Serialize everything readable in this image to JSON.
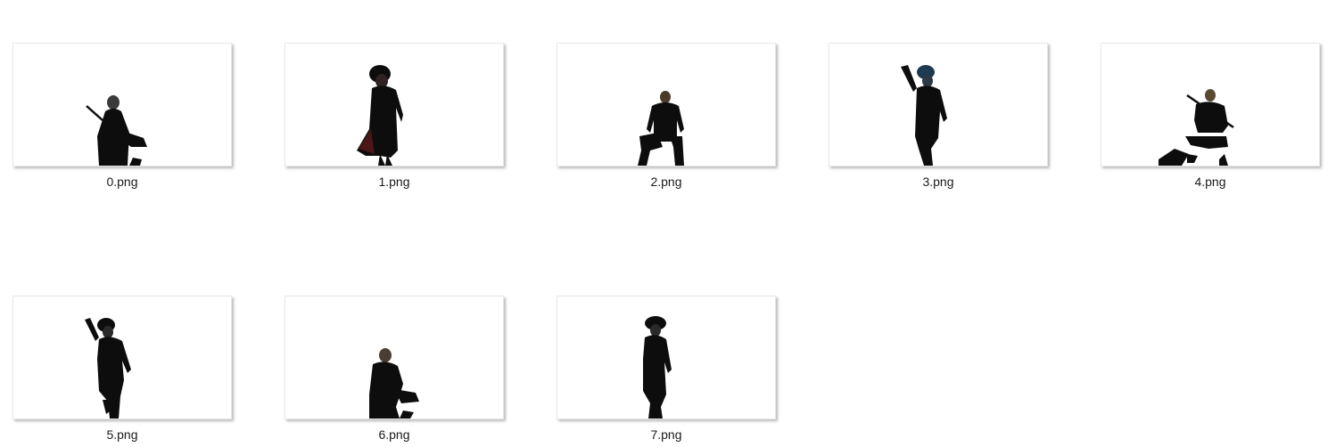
{
  "files": [
    {
      "name": "0.png",
      "thumbnail": "figure-with-sword-crouching-icon"
    },
    {
      "name": "1.png",
      "thumbnail": "figure-in-long-coat-walking-icon"
    },
    {
      "name": "2.png",
      "thumbnail": "figure-kneeling-icon"
    },
    {
      "name": "3.png",
      "thumbnail": "figure-with-raised-weapon-icon"
    },
    {
      "name": "4.png",
      "thumbnail": "figure-crouching-with-sword-icon"
    },
    {
      "name": "5.png",
      "thumbnail": "figure-with-rifle-walking-icon"
    },
    {
      "name": "6.png",
      "thumbnail": "figure-crouching-icon"
    },
    {
      "name": "7.png",
      "thumbnail": "figure-standing-icon"
    }
  ]
}
